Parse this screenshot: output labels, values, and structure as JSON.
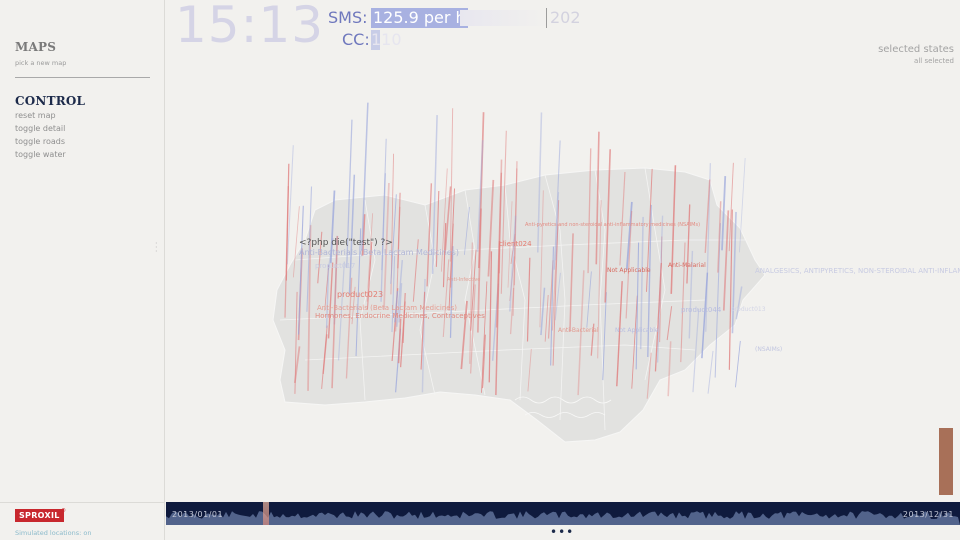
{
  "header": {
    "clock": "15:13",
    "sms_label": "SMS:",
    "sms_value": "125.9 per h",
    "sms_count": "202",
    "cc_label": "CC:",
    "cc_value": "110"
  },
  "sidebar": {
    "maps_title": "MAPS",
    "maps_sub": "pick a new map",
    "control_title": "CONTROL",
    "controls": [
      "reset map",
      "toggle detail",
      "toggle roads",
      "toggle water"
    ],
    "logo": "SPROXIL",
    "logo_mark": "®",
    "footer": "Simulated locations: on"
  },
  "selection": {
    "title": "selected states",
    "value": "all selected"
  },
  "map_labels": {
    "php": "<?php die(\"test\") ?>",
    "beta1": "Anti-Bacterials (Beta Lactam Medicines)",
    "prod017": "product017",
    "prod023": "product023",
    "beta2": "Anti-Bacterials (Beta Lactam Medicines)",
    "hormones": "Hormones, Endocrine Medicines, Contraceptives",
    "nsaim": "Anti-pyretics and non-steroidal anti-inflammatory medicines (NSAIMs)",
    "client": "client024",
    "notapp": "Not Applicable",
    "antimal": "Anti-Malarial",
    "analgesics": "ANALGESICS, ANTIPYRETICS, NON-STEROIDAL ANTI-INFLAM",
    "prod044": "product044",
    "prod013": "product013",
    "antibac": "Anti-Bacterial",
    "notapp2": "Not Applicable",
    "nsaims_short": "(NSAIMs)",
    "antiinf": "Anti-Infective"
  },
  "timeline": {
    "start": "2013/01/01",
    "end": "2013/12/31"
  },
  "colors": {
    "accent": "#6f78bd",
    "brand": "#c8282e",
    "timeline_bg": "#0f1a3d",
    "spike_red": "#e07c7c",
    "spike_blue": "#9aa6dc"
  }
}
